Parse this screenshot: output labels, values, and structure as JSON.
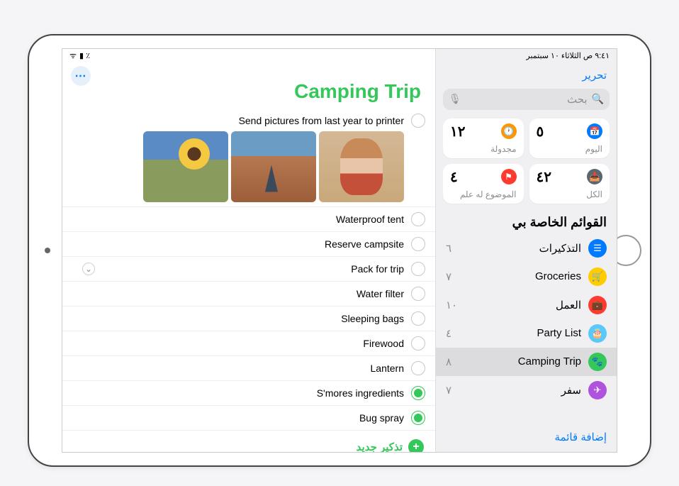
{
  "status": {
    "time_date": "٩:٤١ ص  الثلاثاء ١٠ سبتمبر",
    "battery": "٪",
    "wifi": "📶"
  },
  "sidebar": {
    "edit": "تحرير",
    "search_placeholder": "بحث",
    "smart": {
      "today": {
        "label": "اليوم",
        "count": "٥"
      },
      "scheduled": {
        "label": "مجدولة",
        "count": "١٢"
      },
      "all": {
        "label": "الكل",
        "count": "٤٢"
      },
      "flagged": {
        "label": "الموضوع له علم",
        "count": "٤"
      }
    },
    "my_lists_title": "القوائم الخاصة بي",
    "lists": [
      {
        "name": "التذكيرات",
        "count": "٦",
        "color": "li-blue",
        "icon": "☰"
      },
      {
        "name": "Groceries",
        "count": "٧",
        "color": "li-yellow",
        "icon": "🛒"
      },
      {
        "name": "العمل",
        "count": "١٠",
        "color": "li-red",
        "icon": "💼"
      },
      {
        "name": "Party List",
        "count": "٤",
        "color": "li-cyan",
        "icon": "🎂"
      },
      {
        "name": "Camping Trip",
        "count": "٨",
        "color": "li-green",
        "icon": "🐾",
        "selected": true
      },
      {
        "name": "سفر",
        "count": "٧",
        "color": "li-purple",
        "icon": "✈"
      }
    ],
    "add_list": "إضافة قائمة"
  },
  "content": {
    "title": "Camping Trip",
    "reminders": [
      {
        "text": "Send pictures from last year to printer",
        "done": false,
        "has_photos": true
      },
      {
        "text": "Waterproof tent",
        "done": false
      },
      {
        "text": "Reserve campsite",
        "done": false
      },
      {
        "text": "Pack for trip",
        "done": false,
        "expandable": true
      },
      {
        "text": "Water filter",
        "done": false
      },
      {
        "text": "Sleeping bags",
        "done": false
      },
      {
        "text": "Firewood",
        "done": false
      },
      {
        "text": "Lantern",
        "done": false
      },
      {
        "text": "S'mores ingredients",
        "done": true
      },
      {
        "text": "Bug spray",
        "done": true
      }
    ],
    "new_reminder": "تذكير جديد",
    "more": "⋯"
  }
}
